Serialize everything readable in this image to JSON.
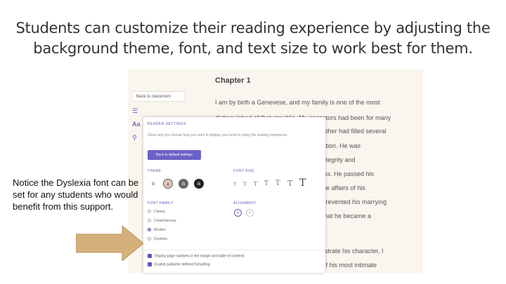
{
  "slide": {
    "title": "Students can customize their reading experience by adjusting the background theme, font, and text size to work best for them.",
    "note": "Notice the Dyslexia font can be set for any students who would benefit from this support."
  },
  "app": {
    "back_label": "Back to classroom",
    "chapter_title": "Chapter 1",
    "book_lines_full": [
      "I am by birth a Genevese, and my family is one of the most",
      "distinguished of that republic. My ancestors had been for many"
    ],
    "book_lines_tail": [
      "r father had filled several",
      "utation. He was",
      "r integrity and",
      "ness. He passed his",
      "r the affairs of his",
      "d prevented his marrying",
      "e that he became a",
      "illustrate his character, I",
      "e of his most intimate"
    ]
  },
  "settings": {
    "title": "READER SETTINGS",
    "description": "Glose lets you choose how you want to display your book to enjoy the reading experience.",
    "reset_label": "Back to default settings",
    "theme_label": "THEME",
    "font_size_label": "FONT SIZE",
    "font_family_label": "FONT FAMILY",
    "alignment_label": "ALIGNMENT",
    "theme_glyph": "a",
    "font_size_glyph": "T",
    "font_families": [
      "Classic",
      "Contemporary",
      "Modern",
      "Dyslexia"
    ],
    "selected_font": "Modern",
    "checks": [
      "Display page numbers in the margin and table of contents",
      "Enable publisher defined formatting"
    ]
  },
  "colors": {
    "accent": "#6a62c6",
    "arrow": "#d4b07a",
    "page_bg": "#faf5ee"
  },
  "icons": [
    "list-icon",
    "font-icon",
    "search-icon",
    "right-arrow-icon"
  ]
}
